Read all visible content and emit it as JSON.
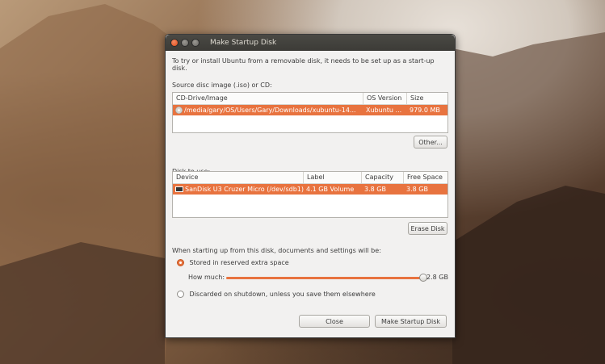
{
  "window": {
    "title": "Make Startup Disk",
    "intro": "To try or install Ubuntu from a removable disk, it needs to be set up as a start-up disk."
  },
  "source": {
    "label": "Source disc image (.iso) or CD:",
    "columns": [
      "CD-Drive/Image",
      "OS Version",
      "Size"
    ],
    "rows": [
      {
        "image": "/media/gary/OS/Users/Gary/Downloads/xubuntu-14...",
        "os_version": "Xubuntu ...",
        "size": "979.0 MB"
      }
    ],
    "other_button": "Other..."
  },
  "disk": {
    "label": "Disk to use:",
    "columns": [
      "Device",
      "Label",
      "Capacity",
      "Free Space"
    ],
    "rows": [
      {
        "device": "SanDisk U3 Cruzer Micro (/dev/sdb1)",
        "label": "4.1 GB Volume",
        "capacity": "3.8 GB",
        "free_space": "3.8 GB"
      }
    ],
    "erase_button": "Erase Disk"
  },
  "options": {
    "prompt": "When starting up from this disk, documents and settings will be:",
    "stored_label": "Stored in reserved extra space",
    "how_much_label": "How much:",
    "how_much_value": "2.8 GB",
    "slider_fraction": 1.0,
    "discarded_label": "Discarded on shutdown, unless you save them elsewhere"
  },
  "buttons": {
    "close": "Close",
    "make": "Make Startup Disk"
  },
  "colors": {
    "accent": "#e8733f",
    "titlebar": "#3c3b37"
  }
}
